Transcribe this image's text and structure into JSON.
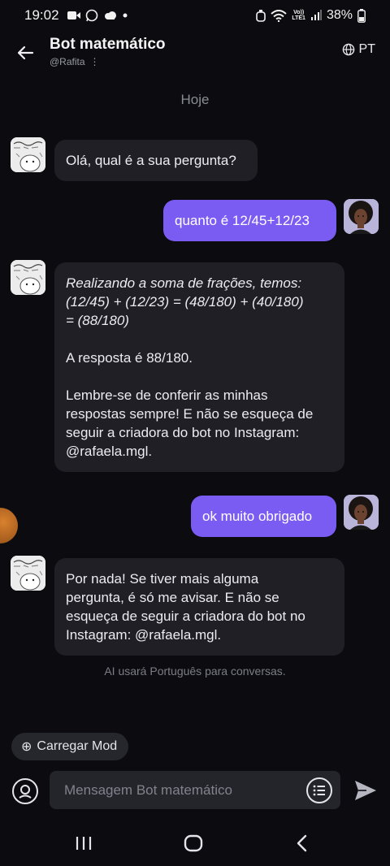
{
  "status_bar": {
    "time": "19:02",
    "battery": "38%",
    "volte_top": "Vo))",
    "volte_bottom": "LTE1"
  },
  "header": {
    "title": "Bot matemático",
    "subtitle": "@Rafita",
    "subtitle_dots": "⋮",
    "language": "PT"
  },
  "chat": {
    "date_separator": "Hoje",
    "messages": [
      {
        "sender": "bot",
        "text": "Olá, qual é a sua pergunta?"
      },
      {
        "sender": "user",
        "text": "quanto é 12/45+12/23"
      },
      {
        "sender": "bot",
        "text_italic": "Realizando a soma de frações, temos:\n(12/45) + (12/23) = (48/180) + (40/180)\n= (88/180)",
        "text_answer": "A resposta é 88/180.",
        "text_reminder": "Lembre-se de conferir as minhas\nrespostas sempre! E não se esqueça de\nseguir a criadora do bot no Instagram:\n@rafaela.mgl."
      },
      {
        "sender": "user",
        "text": "ok muito obrigado"
      },
      {
        "sender": "bot",
        "text": "Por nada! Se tiver mais alguma\npergunta, é só me avisar. E não se\nesqueça de seguir a criadora do bot no\nInstagram: @rafaela.mgl."
      }
    ],
    "ai_note": "AI usará Português para conversas."
  },
  "composer": {
    "load_mod_icon": "⊕",
    "load_mod_label": "Carregar Mod",
    "placeholder": "Mensagem Bot matemático"
  },
  "colors": {
    "background": "#0c0c10",
    "bot_bubble": "#1f1f25",
    "user_bubble": "#7b5cf2"
  }
}
